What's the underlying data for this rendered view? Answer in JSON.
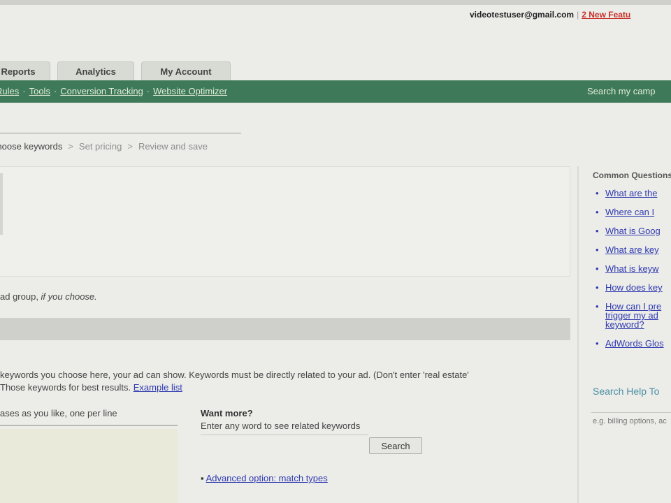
{
  "header": {
    "account_email": "videotestuser@gmail.com",
    "separator": "|",
    "new_features": "2 New Featu"
  },
  "tabs": [
    {
      "label": "Reports"
    },
    {
      "label": "Analytics"
    },
    {
      "label": "My Account"
    }
  ],
  "nav": {
    "links": [
      "Rules",
      "Tools",
      "Conversion Tracking",
      "Website Optimizer"
    ],
    "search_label": "Search my camp"
  },
  "steps": {
    "current": "Choose keywords",
    "next1": "Set pricing",
    "next2": "Review and save",
    "arrow": ">"
  },
  "main": {
    "adgroup_note_prefix": "ad group, ",
    "adgroup_note_italic": "if you choose.",
    "keyword_desc_line1": "keywords you choose here, your ad can show. Keywords must be directly related to your ad. (Don't enter 'real estate'",
    "keyword_desc_line2": "Those keywords for best results. ",
    "example_link": "Example list",
    "keyword_box_label": "ases as you like, one per line",
    "want_more_title": "Want more?",
    "want_more_sub": "Enter any word to see related keywords",
    "search_button": "Search",
    "advanced_bullet": "▪",
    "advanced_link": "Advanced option: match types"
  },
  "sidebar": {
    "title": "Common Questions",
    "questions": [
      "What are the",
      "Where can I",
      "What is Goog",
      "What are key",
      "What is keyw",
      "How does key",
      "How can I pre trigger my ad keyword?",
      "AdWords Glos"
    ],
    "help_title": "Search Help To",
    "help_hint": "e.g. billing options, ac"
  }
}
